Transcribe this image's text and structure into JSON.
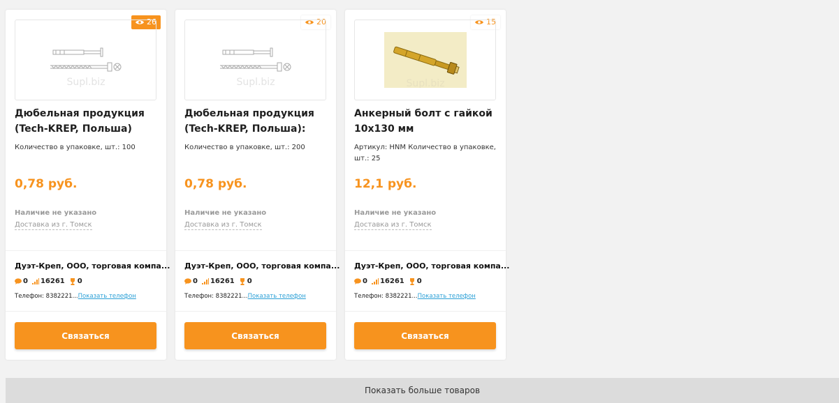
{
  "products": [
    {
      "views": "26",
      "title": "Дюбельная продукция (Tech-KREP, Польша)",
      "desc": "Количество в упаковке, шт.: 100",
      "price": "0,78 руб.",
      "stock": "Наличие не указано",
      "delivery": "Доставка из г. Томск",
      "seller": "Дуэт-Креп, ООО, торговая компа...",
      "comments": "0",
      "rating": "16261",
      "awards": "0",
      "phone_prefix": "Телефон: 8382221...",
      "phone_link": "Показать телефон",
      "contact_label": "Связаться",
      "watermark": "Supl.biz",
      "image": "dowel-drawing"
    },
    {
      "views": "20",
      "title": "Дюбельная продукция (Tech-KREP, Польша):",
      "desc": "Количество в упаковке, шт.: 200",
      "price": "0,78 руб.",
      "stock": "Наличие не указано",
      "delivery": "Доставка из г. Томск",
      "seller": "Дуэт-Креп, ООО, торговая компа...",
      "comments": "0",
      "rating": "16261",
      "awards": "0",
      "phone_prefix": "Телефон: 8382221...",
      "phone_link": "Показать телефон",
      "contact_label": "Связаться",
      "watermark": "Supl.biz",
      "image": "dowel-drawing"
    },
    {
      "views": "15",
      "title": "Анкерный болт с гайкой 10х130 мм",
      "desc": "Артикул: HNM Количество в упаковке, шт.: 25",
      "price": "12,1 руб.",
      "stock": "Наличие не указано",
      "delivery": "Доставка из г. Томск",
      "seller": "Дуэт-Креп, ООО, торговая компа...",
      "comments": "0",
      "rating": "16261",
      "awards": "0",
      "phone_prefix": "Телефон: 8382221...",
      "phone_link": "Показать телефон",
      "contact_label": "Связаться",
      "watermark": "Supl.biz",
      "image": "anchor-bolt-photo"
    }
  ],
  "more_button": "Показать больше товаров",
  "colors": {
    "accent": "#f7931e",
    "link": "#2a9fd6",
    "background": "#f2f2f2"
  }
}
